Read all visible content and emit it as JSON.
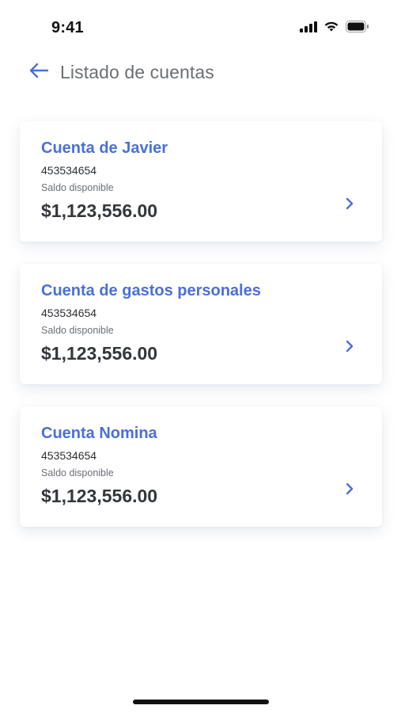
{
  "status_bar": {
    "time": "9:41",
    "icons": [
      "signal-icon",
      "wifi-icon",
      "battery-icon"
    ]
  },
  "header": {
    "back_icon": "arrow-left-icon",
    "title": "Listado de cuentas"
  },
  "accounts": [
    {
      "name": "Cuenta de Javier",
      "number": "453534654",
      "balance_label": "Saldo disponible",
      "balance": "$1,123,556.00"
    },
    {
      "name": "Cuenta de gastos personales",
      "number": "453534654",
      "balance_label": "Saldo disponible",
      "balance": "$1,123,556.00"
    },
    {
      "name": "Cuenta Nomina",
      "number": "453534654",
      "balance_label": "Saldo disponible",
      "balance": "$1,123,556.00"
    }
  ],
  "colors": {
    "accent": "#4a6fd8",
    "title": "#6b6f75",
    "text": "#33363a",
    "background": "#ffffff"
  }
}
